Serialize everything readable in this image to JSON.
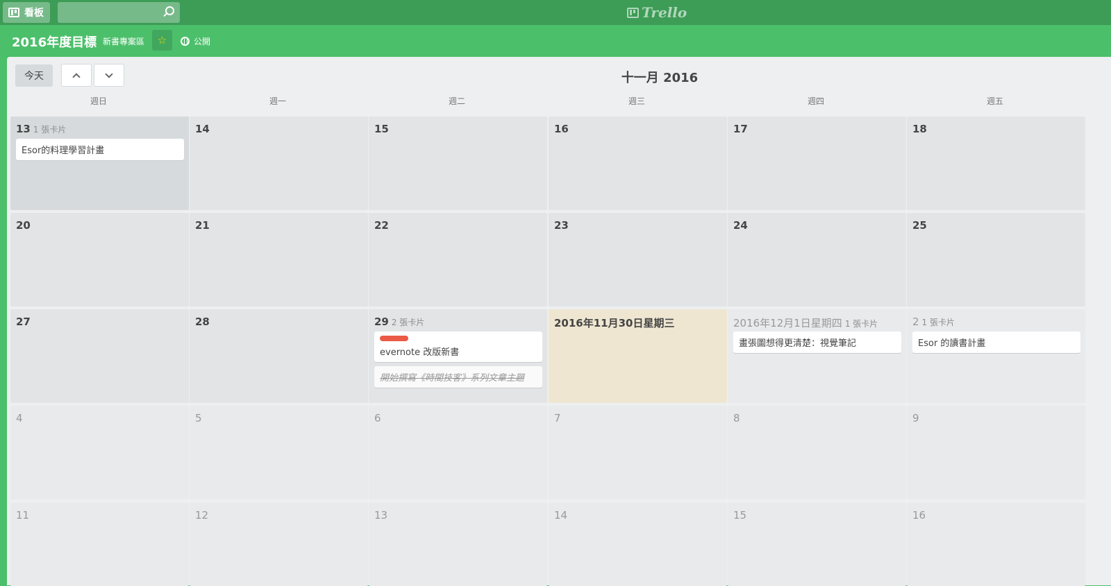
{
  "header": {
    "boards_label": "看板",
    "logo_text": "Trello"
  },
  "board": {
    "title": "2016年度目標",
    "team": "新書專案區",
    "visibility": "公開"
  },
  "calendar": {
    "today_label": "今天",
    "month_title": "十一月 2016",
    "weekdays": [
      "週日",
      "週一",
      "週二",
      "週三",
      "週四",
      "週五"
    ],
    "weeks": [
      [
        {
          "date": "13",
          "count": "1 張卡片",
          "cards": [
            "Esor的料理學習計畫"
          ]
        },
        {
          "date": "14"
        },
        {
          "date": "15"
        },
        {
          "date": "16"
        },
        {
          "date": "17"
        },
        {
          "date": "18"
        }
      ],
      [
        {
          "date": "20"
        },
        {
          "date": "21"
        },
        {
          "date": "22"
        },
        {
          "date": "23"
        },
        {
          "date": "24"
        },
        {
          "date": "25"
        }
      ],
      [
        {
          "date": "27"
        },
        {
          "date": "28"
        },
        {
          "date": "29",
          "count": "2 張卡片",
          "cards": [
            "evernote 改版新書",
            "開始撰寫《時間技客》系列文章主題"
          ]
        },
        {
          "date": "2016年11月30日星期三"
        },
        {
          "date": "2016年12月1日星期四",
          "count": "1 張卡片",
          "cards": [
            "畫張圖想得更清楚：視覺筆記"
          ]
        },
        {
          "date": "2",
          "count": "1 張卡片",
          "cards": [
            "Esor 的讀書計畫"
          ]
        }
      ],
      [
        {
          "date": "4"
        },
        {
          "date": "5"
        },
        {
          "date": "6"
        },
        {
          "date": "7"
        },
        {
          "date": "8"
        },
        {
          "date": "9"
        }
      ],
      [
        {
          "date": "11"
        },
        {
          "date": "12"
        },
        {
          "date": "13"
        },
        {
          "date": "14"
        },
        {
          "date": "15"
        },
        {
          "date": "16"
        }
      ]
    ]
  },
  "colors": {
    "header_dark": "#3d9c56",
    "board_green": "#4cbf6b",
    "label_red": "#eb5a46",
    "today_bg": "#eee6d1"
  }
}
